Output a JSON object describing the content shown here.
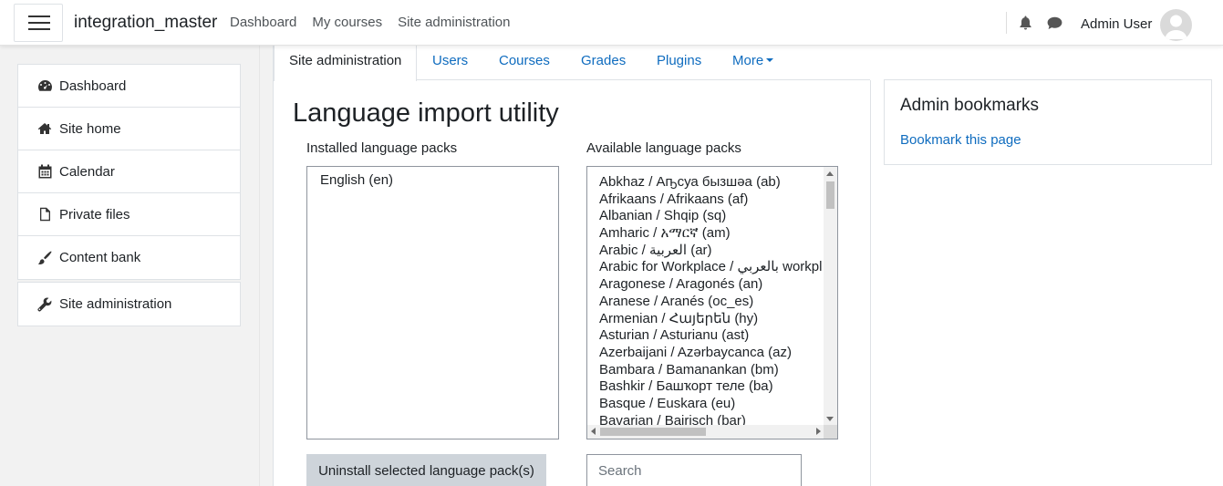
{
  "navbar": {
    "site_name": "integration_master",
    "links": [
      "Dashboard",
      "My courses",
      "Site administration"
    ],
    "user_name": "Admin User"
  },
  "drawer": {
    "items": [
      {
        "label": "Dashboard",
        "icon": "dashboard-icon"
      },
      {
        "label": "Site home",
        "icon": "home-icon"
      },
      {
        "label": "Calendar",
        "icon": "calendar-icon"
      },
      {
        "label": "Private files",
        "icon": "file-icon"
      },
      {
        "label": "Content bank",
        "icon": "paintbrush-icon"
      }
    ],
    "admin_item": {
      "label": "Site administration",
      "icon": "wrench-icon"
    }
  },
  "tabs": {
    "items": [
      "Site administration",
      "Users",
      "Courses",
      "Grades",
      "Plugins",
      "More"
    ],
    "active": "Site administration"
  },
  "main": {
    "title": "Language import utility",
    "installed_label": "Installed language packs",
    "available_label": "Available language packs",
    "installed": [
      "English (en)"
    ],
    "available": [
      "Abkhaz / Аҧсуа бызшәа (ab)",
      "Afrikaans / Afrikaans (af)",
      "Albanian / Shqip (sq)",
      "Amharic / አማርኛ (am)",
      "Arabic / العربية (ar)",
      "Arabic for Workplace / بالعربي workpl",
      "Aragonese / Aragonés (an)",
      "Aranese / Aranés (oc_es)",
      "Armenian / Հայերեն (hy)",
      "Asturian / Asturianu (ast)",
      "Azerbaijani / Azərbaycanca (az)",
      "Bambara / Bamanankan (bm)",
      "Bashkir / Башҡорт теле (ba)",
      "Basque / Euskara (eu)",
      "Bavarian / Bairisch (bar)"
    ],
    "uninstall_button": "Uninstall selected language pack(s)",
    "search_placeholder": "Search"
  },
  "block": {
    "title": "Admin bookmarks",
    "link": "Bookmark this page"
  },
  "colors": {
    "link": "#0f6cbf",
    "text": "#1d2125",
    "background": "#f2f2f2",
    "button_disabled": "#ced4da"
  }
}
